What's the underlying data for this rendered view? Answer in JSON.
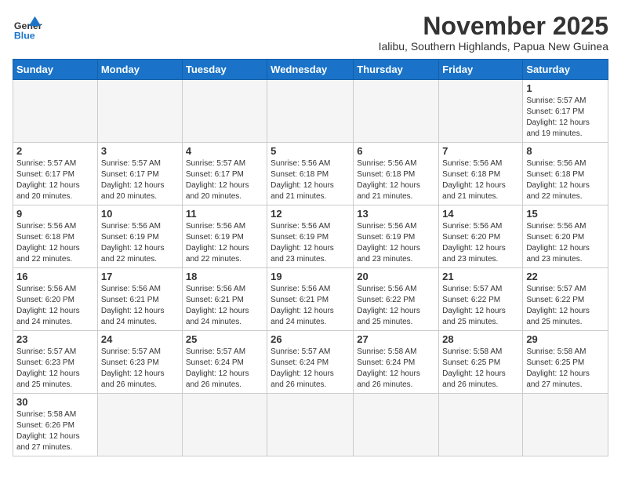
{
  "logo": {
    "general": "General",
    "blue": "Blue"
  },
  "title": "November 2025",
  "subtitle": "Ialibu, Southern Highlands, Papua New Guinea",
  "headers": [
    "Sunday",
    "Monday",
    "Tuesday",
    "Wednesday",
    "Thursday",
    "Friday",
    "Saturday"
  ],
  "weeks": [
    [
      {
        "day": "",
        "info": "",
        "empty": true
      },
      {
        "day": "",
        "info": "",
        "empty": true
      },
      {
        "day": "",
        "info": "",
        "empty": true
      },
      {
        "day": "",
        "info": "",
        "empty": true
      },
      {
        "day": "",
        "info": "",
        "empty": true
      },
      {
        "day": "",
        "info": "",
        "empty": true
      },
      {
        "day": "1",
        "info": "Sunrise: 5:57 AM\nSunset: 6:17 PM\nDaylight: 12 hours\nand 19 minutes."
      }
    ],
    [
      {
        "day": "2",
        "info": "Sunrise: 5:57 AM\nSunset: 6:17 PM\nDaylight: 12 hours\nand 20 minutes."
      },
      {
        "day": "3",
        "info": "Sunrise: 5:57 AM\nSunset: 6:17 PM\nDaylight: 12 hours\nand 20 minutes."
      },
      {
        "day": "4",
        "info": "Sunrise: 5:57 AM\nSunset: 6:17 PM\nDaylight: 12 hours\nand 20 minutes."
      },
      {
        "day": "5",
        "info": "Sunrise: 5:56 AM\nSunset: 6:18 PM\nDaylight: 12 hours\nand 21 minutes."
      },
      {
        "day": "6",
        "info": "Sunrise: 5:56 AM\nSunset: 6:18 PM\nDaylight: 12 hours\nand 21 minutes."
      },
      {
        "day": "7",
        "info": "Sunrise: 5:56 AM\nSunset: 6:18 PM\nDaylight: 12 hours\nand 21 minutes."
      },
      {
        "day": "8",
        "info": "Sunrise: 5:56 AM\nSunset: 6:18 PM\nDaylight: 12 hours\nand 22 minutes."
      }
    ],
    [
      {
        "day": "9",
        "info": "Sunrise: 5:56 AM\nSunset: 6:18 PM\nDaylight: 12 hours\nand 22 minutes."
      },
      {
        "day": "10",
        "info": "Sunrise: 5:56 AM\nSunset: 6:19 PM\nDaylight: 12 hours\nand 22 minutes."
      },
      {
        "day": "11",
        "info": "Sunrise: 5:56 AM\nSunset: 6:19 PM\nDaylight: 12 hours\nand 22 minutes."
      },
      {
        "day": "12",
        "info": "Sunrise: 5:56 AM\nSunset: 6:19 PM\nDaylight: 12 hours\nand 23 minutes."
      },
      {
        "day": "13",
        "info": "Sunrise: 5:56 AM\nSunset: 6:19 PM\nDaylight: 12 hours\nand 23 minutes."
      },
      {
        "day": "14",
        "info": "Sunrise: 5:56 AM\nSunset: 6:20 PM\nDaylight: 12 hours\nand 23 minutes."
      },
      {
        "day": "15",
        "info": "Sunrise: 5:56 AM\nSunset: 6:20 PM\nDaylight: 12 hours\nand 23 minutes."
      }
    ],
    [
      {
        "day": "16",
        "info": "Sunrise: 5:56 AM\nSunset: 6:20 PM\nDaylight: 12 hours\nand 24 minutes."
      },
      {
        "day": "17",
        "info": "Sunrise: 5:56 AM\nSunset: 6:21 PM\nDaylight: 12 hours\nand 24 minutes."
      },
      {
        "day": "18",
        "info": "Sunrise: 5:56 AM\nSunset: 6:21 PM\nDaylight: 12 hours\nand 24 minutes."
      },
      {
        "day": "19",
        "info": "Sunrise: 5:56 AM\nSunset: 6:21 PM\nDaylight: 12 hours\nand 24 minutes."
      },
      {
        "day": "20",
        "info": "Sunrise: 5:56 AM\nSunset: 6:22 PM\nDaylight: 12 hours\nand 25 minutes."
      },
      {
        "day": "21",
        "info": "Sunrise: 5:57 AM\nSunset: 6:22 PM\nDaylight: 12 hours\nand 25 minutes."
      },
      {
        "day": "22",
        "info": "Sunrise: 5:57 AM\nSunset: 6:22 PM\nDaylight: 12 hours\nand 25 minutes."
      }
    ],
    [
      {
        "day": "23",
        "info": "Sunrise: 5:57 AM\nSunset: 6:23 PM\nDaylight: 12 hours\nand 25 minutes."
      },
      {
        "day": "24",
        "info": "Sunrise: 5:57 AM\nSunset: 6:23 PM\nDaylight: 12 hours\nand 26 minutes."
      },
      {
        "day": "25",
        "info": "Sunrise: 5:57 AM\nSunset: 6:24 PM\nDaylight: 12 hours\nand 26 minutes."
      },
      {
        "day": "26",
        "info": "Sunrise: 5:57 AM\nSunset: 6:24 PM\nDaylight: 12 hours\nand 26 minutes."
      },
      {
        "day": "27",
        "info": "Sunrise: 5:58 AM\nSunset: 6:24 PM\nDaylight: 12 hours\nand 26 minutes."
      },
      {
        "day": "28",
        "info": "Sunrise: 5:58 AM\nSunset: 6:25 PM\nDaylight: 12 hours\nand 26 minutes."
      },
      {
        "day": "29",
        "info": "Sunrise: 5:58 AM\nSunset: 6:25 PM\nDaylight: 12 hours\nand 27 minutes."
      }
    ],
    [
      {
        "day": "30",
        "info": "Sunrise: 5:58 AM\nSunset: 6:26 PM\nDaylight: 12 hours\nand 27 minutes."
      },
      {
        "day": "",
        "info": "",
        "empty": true
      },
      {
        "day": "",
        "info": "",
        "empty": true
      },
      {
        "day": "",
        "info": "",
        "empty": true
      },
      {
        "day": "",
        "info": "",
        "empty": true
      },
      {
        "day": "",
        "info": "",
        "empty": true
      },
      {
        "day": "",
        "info": "",
        "empty": true
      }
    ]
  ]
}
